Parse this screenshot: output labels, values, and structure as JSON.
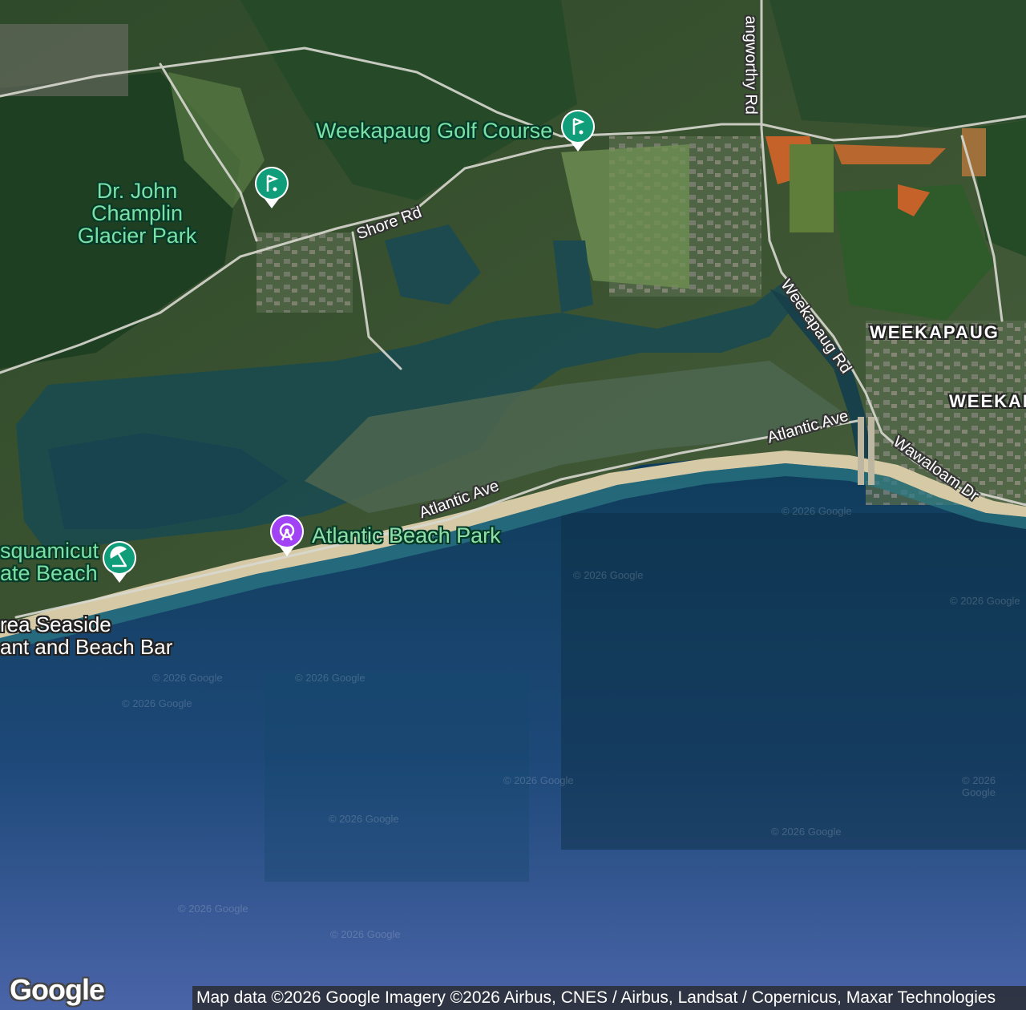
{
  "map": {
    "type": "satellite",
    "places": {
      "golf_course": "Weekapaug Golf Course",
      "glacier_park": [
        "Dr. John",
        "Champlin",
        "Glacier Park"
      ],
      "beach_park": "Atlantic Beach Park",
      "state_beach": [
        "squamicut",
        "ate Beach"
      ],
      "restaurant": [
        "rea Seaside",
        "ant and Beach Bar"
      ],
      "town_1": "WEEKAPAUG",
      "town_2": "WEEKAP"
    },
    "roads": {
      "shore_rd": "Shore Rd",
      "atlantic_ave_1": "Atlantic Ave",
      "atlantic_ave_2": "Atlantic Ave",
      "weekapaug_rd": "Weekapaug Rd",
      "langworthy_rd": "angworthy Rd",
      "wawaloam_dr": "Wawaloam Dr"
    },
    "icons": {
      "golf": "golf-icon",
      "golf_2": "golf-icon",
      "beach": "beach-umbrella-icon",
      "park": "amusement-park-icon"
    },
    "colors": {
      "golf_pin": "#0f9d7a",
      "park_pin": "#a142f4",
      "beach_pin": "#0f9d7a"
    },
    "watermark": "© 2026 Google"
  },
  "footer": {
    "logo": "Google",
    "attribution": "Map data ©2026 Google Imagery ©2026 Airbus, CNES / Airbus, Landsat / Copernicus, Maxar Technologies"
  }
}
